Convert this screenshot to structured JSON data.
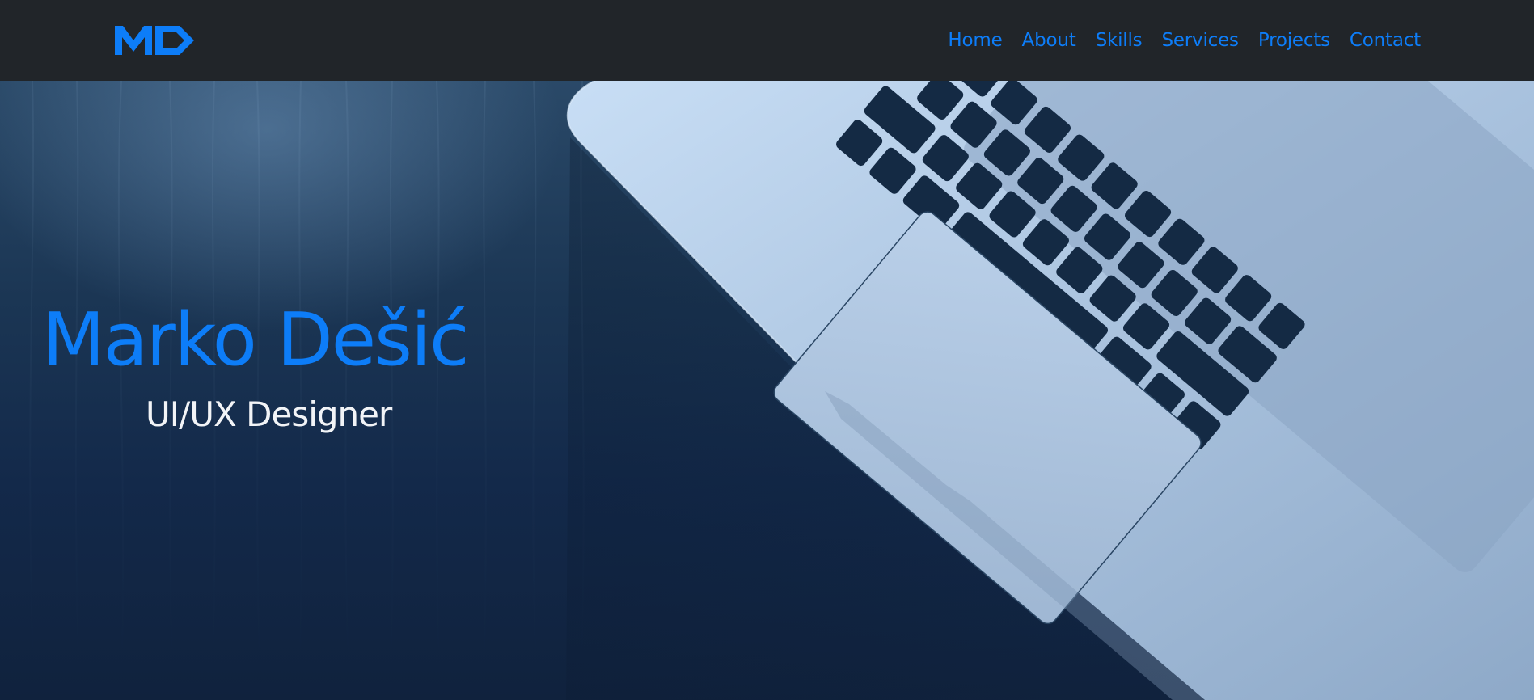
{
  "navbar": {
    "logo_text": "MD",
    "links": [
      {
        "label": "Home"
      },
      {
        "label": "About"
      },
      {
        "label": "Skills"
      },
      {
        "label": "Services"
      },
      {
        "label": "Projects"
      },
      {
        "label": "Contact"
      }
    ]
  },
  "hero": {
    "name": "Marko Dešić",
    "role": "UI/UX Designer",
    "background_image": "laptop-on-desk"
  },
  "colors": {
    "accent": "#0d7df8",
    "navbar_bg": "#212529",
    "hero_bg": "#10243d",
    "text_light": "#f2f4f7"
  }
}
